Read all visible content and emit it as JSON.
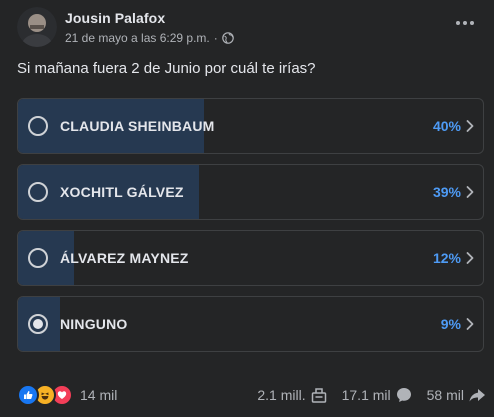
{
  "post": {
    "author": "Jousin Palafox",
    "date": "21 de mayo a las 6:29 p.m.",
    "separator": "·",
    "privacy_icon": "globe-icon",
    "more_icon": "more-horizontal-icon",
    "question": "Si mañana fuera 2 de Junio por cuál te irías?"
  },
  "poll": {
    "options": [
      {
        "label": "CLAUDIA SHEINBAUM",
        "percent_text": "40%",
        "percent": 40,
        "selected": false
      },
      {
        "label": "XOCHITL GÁLVEZ",
        "percent_text": "39%",
        "percent": 39,
        "selected": false
      },
      {
        "label": "ÁLVAREZ MAYNEZ",
        "percent_text": "12%",
        "percent": 12,
        "selected": false
      },
      {
        "label": "NINGUNO",
        "percent_text": "9%",
        "percent": 9,
        "selected": true
      }
    ]
  },
  "footer": {
    "reaction_icons": [
      "like-icon",
      "haha-icon",
      "love-icon"
    ],
    "reactions_count": "14 mil",
    "comments_count": "2.1 mill.",
    "comments_icon": "voted-icon",
    "views_count": "17.1 mil",
    "views_icon": "comment-bubble-icon",
    "shares_count": "58 mil",
    "shares_icon": "share-icon"
  },
  "colors": {
    "background": "#242526",
    "bar_fill": "#263951",
    "percent_blue": "#4e9bf5",
    "border": "#3e4042"
  }
}
